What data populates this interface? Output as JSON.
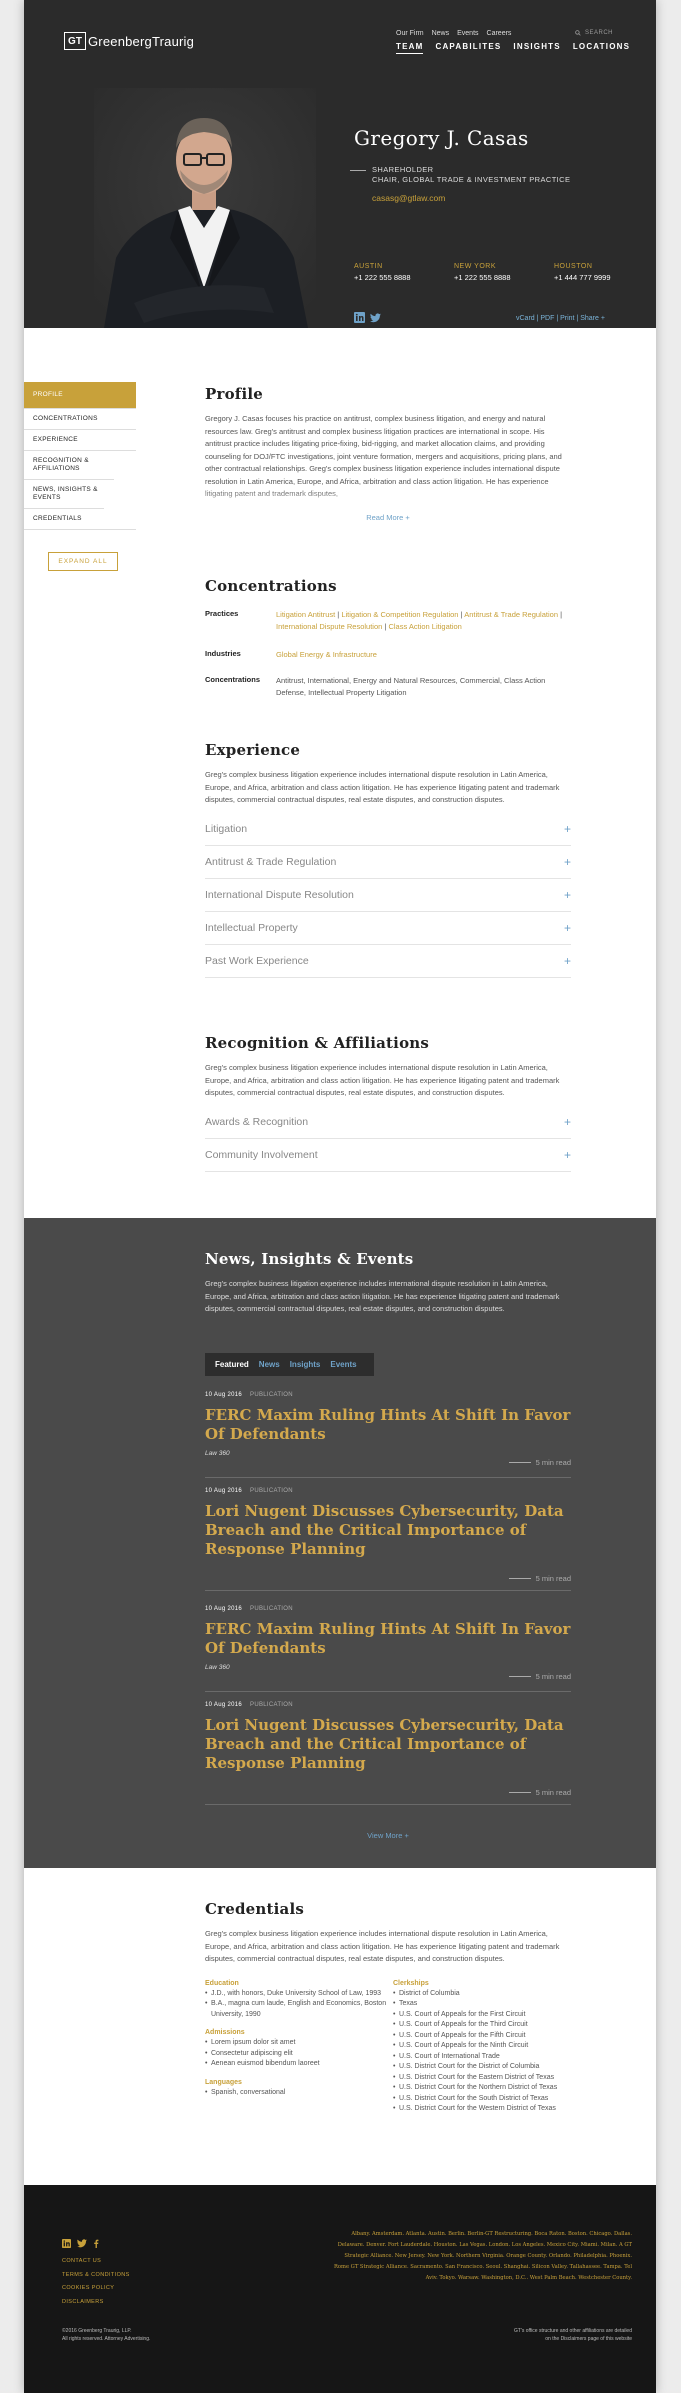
{
  "brand": {
    "mark": "GT",
    "name": "GreenbergTraurig"
  },
  "utility_nav": [
    "Our Firm",
    "News",
    "Events",
    "Careers"
  ],
  "search": {
    "label": "SEARCH"
  },
  "main_nav": [
    "TEAM",
    "CAPABILITES",
    "INSIGHTS",
    "LOCATIONS"
  ],
  "profile_head": {
    "name": "Gregory J. Casas",
    "role": "SHAREHOLDER",
    "practice": "CHAIR, GLOBAL TRADE & INVESTMENT PRACTICE",
    "email": "casasg@gtlaw.com",
    "offices": [
      {
        "city": "AUSTIN",
        "phone": "+1 222 555 8888"
      },
      {
        "city": "NEW YORK",
        "phone": "+1 222 555 8888"
      },
      {
        "city": "HOUSTON",
        "phone": "+1 444 777 9999"
      }
    ],
    "links": "vCard | PDF | Print | Share +"
  },
  "sidebar": {
    "items": [
      "PROFILE",
      "CONCENTRATIONS",
      "EXPERIENCE",
      "RECOGNITION & AFFILIATIONS",
      "NEWS, INSIGHTS & EVENTS",
      "CREDENTIALS"
    ],
    "expand": "EXPAND ALL"
  },
  "profile": {
    "title": "Profile",
    "text": "Gregory J. Casas focuses his practice on antitrust, complex business litigation, and energy and natural resources law. Greg's antitrust and complex business litigation practices are international in scope. His antitrust practice includes litigating price-fixing, bid-rigging, and market allocation claims, and providing counseling for DOJ/FTC investigations, joint venture formation, mergers and acquisitions, pricing plans, and other contractual relationships. Greg's complex business litigation experience includes international dispute resolution in Latin America, Europe, and Africa, arbitration and class action litigation. He has experience litigating patent and trademark disputes,",
    "read_more": "Read More +"
  },
  "concentrations": {
    "title": "Concentrations",
    "practices_label": "Practices",
    "practices": [
      "Litigation Antitrust",
      "Litigation & Competition Regulation",
      "Antitrust & Trade Regulation",
      "International Dispute Resolution",
      "Class Action Litigation"
    ],
    "industries_label": "Industries",
    "industries": "Global Energy & Infrastructure",
    "conc_label": "Concentrations",
    "conc": "Antitrust, International, Energy and Natural Resources, Commercial, Class Action Defense, Intellectual Property Litigation"
  },
  "experience": {
    "title": "Experience",
    "text": "Greg's complex business litigation experience includes international dispute resolution in Latin America, Europe, and Africa, arbitration and class action litigation. He has experience litigating patent and trademark disputes, commercial contractual disputes, real estate disputes, and construction disputes.",
    "items": [
      "Litigation",
      "Antitrust & Trade Regulation",
      "International Dispute Resolution",
      "Intellectual Property",
      "Past Work Experience"
    ]
  },
  "recognition": {
    "title": "Recognition & Affiliations",
    "text": "Greg's complex business litigation experience includes international dispute resolution in Latin America, Europe, and Africa, arbitration and class action litigation. He has experience litigating patent and trademark disputes, commercial contractual disputes, real estate disputes, and construction disputes.",
    "items": [
      "Awards & Recognition",
      "Community Involvement"
    ]
  },
  "news": {
    "title": "News, Insights & Events",
    "text": "Greg's complex business litigation experience includes international dispute resolution in Latin America, Europe, and Africa, arbitration and class action litigation. He has experience litigating patent and trademark disputes, commercial contractual disputes, real estate disputes, and construction disputes.",
    "tabs": [
      "Featured",
      "News",
      "Insights",
      "Events"
    ],
    "articles": [
      {
        "date": "10 Aug 2016",
        "type": "PUBLICATION",
        "title": "FERC Maxim Ruling Hints At Shift In Favor Of Defendants",
        "source": "Law 360",
        "read": "5 min read"
      },
      {
        "date": "10 Aug 2016",
        "type": "PUBLICATION",
        "title": "Lori Nugent Discusses Cybersecurity, Data Breach and the Critical Importance of Response Planning",
        "source": "",
        "read": "5 min read"
      },
      {
        "date": "10 Aug 2016",
        "type": "PUBLICATION",
        "title": "FERC Maxim Ruling Hints At Shift In Favor Of Defendants",
        "source": "Law 360",
        "read": "5 min read"
      },
      {
        "date": "10 Aug 2016",
        "type": "PUBLICATION",
        "title": "Lori Nugent Discusses Cybersecurity, Data Breach and the Critical Importance of Response Planning",
        "source": "",
        "read": "5 min read"
      }
    ],
    "view_more": "View More +"
  },
  "credentials": {
    "title": "Credentials",
    "text": "Greg's complex business litigation experience includes international dispute resolution in Latin America, Europe, and Africa, arbitration and class action litigation. He has experience litigating patent and trademark disputes, commercial contractual disputes, real estate disputes, and construction disputes.",
    "education_label": "Education",
    "education": [
      "J.D., with honors, Duke University School of Law, 1993",
      "B.A., magna cum laude, English and Economics, Boston University, 1990"
    ],
    "admissions_label": "Admissions",
    "admissions": [
      "Lorem ipsum dolor sit amet",
      "Consectetur adipiscing elit",
      "Aenean euismod bibendum laoreet"
    ],
    "languages_label": "Languages",
    "languages": [
      "Spanish, conversational"
    ],
    "clerkships_label": "Clerkships",
    "clerkships": [
      "District of Columbia",
      "Texas",
      "U.S. Court of Appeals for the First Circuit",
      "U.S. Court of Appeals for the Third Circuit",
      "U.S. Court of Appeals for the Fifth Circuit",
      "U.S. Court of Appeals for the Ninth Circuit",
      "U.S. Court of International Trade",
      "U.S. District Court for the District of Columbia",
      "U.S. District Court for the Eastern District of Texas",
      "U.S. District Court for the Northern District of Texas",
      "U.S. District Court for the South District of Texas",
      "U.S. District Court for the Western District of Texas"
    ]
  },
  "footer": {
    "links": [
      "CONTACT US",
      "TERMS & CONDITIONS",
      "COOKIES POLICY",
      "DISCLAIMERS"
    ],
    "cities": "Albany. Amsterdam. Atlanta. Austin. Berlin. Berlin-GT Restructuring. Boca Raton. Boston. Chicago. Dallas. Delaware. Denver. Fort Lauderdale. Houston. Las Vegas. London. Los Angeles. Mexico City. Miami. Milan. A GT Strategic Alliance. New Jersey. New York. Northern Virginia. Orange County. Orlando. Philadelphia. Phoenix. Rome GT Strategic Alliance. Sacramento. San Francisco. Seoul. Shanghai. Silicon Valley. Tallahassee. Tampa. Tel Aviv. Tokyo. Warsaw. Washington, D.C.. West Palm Beach. Westchester County.",
    "copyright": "©2016 Greenberg Traurig, LLP.",
    "rights": "All rights reserved. Attorney Advertising.",
    "note1": "GT's office structure and other affiliations are detailed",
    "note2": "on the Disclaimers page of this website"
  },
  "colors": {
    "gold": "#c8a13a",
    "link_blue": "#6fa2c8",
    "hero_bg": "#2b2b2b",
    "news_bg": "#4a4a4a",
    "footer_bg": "#161616"
  }
}
